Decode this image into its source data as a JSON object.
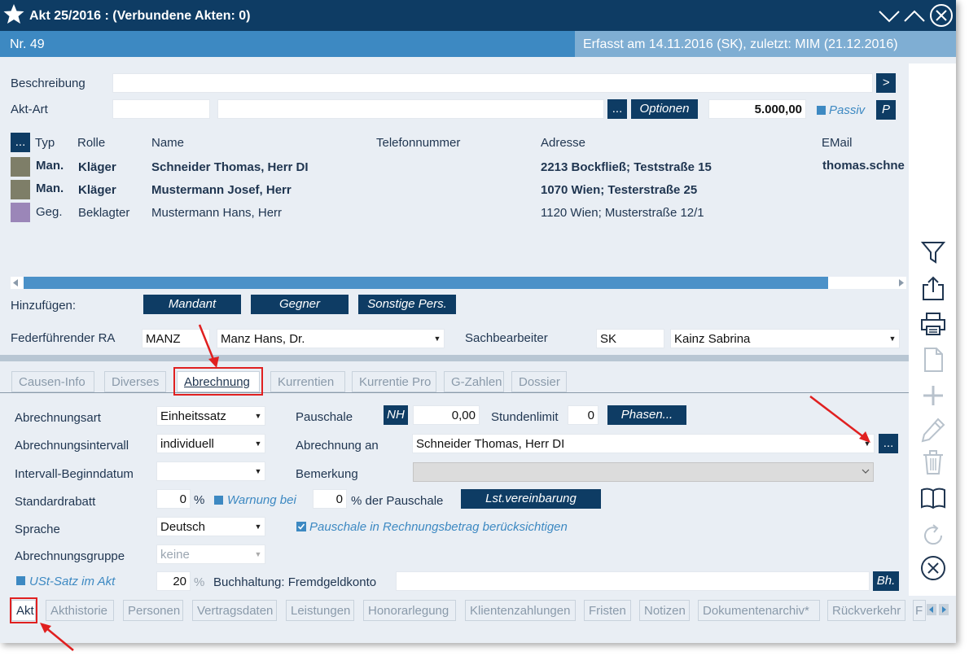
{
  "window": {
    "title": "Akt 25/2016 :  (Verbundene Akten: 0)",
    "nr": "Nr. 49",
    "erfasst": "Erfasst am 14.11.2016 (SK), zuletzt: MIM (21.12.2016)"
  },
  "form": {
    "beschreibung_label": "Beschreibung",
    "beschreibung_value": "",
    "aktart_label": "Akt-Art",
    "aktart_value": "",
    "aktart_desc": "",
    "dots": "...",
    "optionen_label": "Optionen",
    "betrag": "5.000,00",
    "passiv_label": "Passiv",
    "p_label": "P",
    "go_label": ">"
  },
  "persons": {
    "headers": {
      "dots": "...",
      "typ": "Typ",
      "rolle": "Rolle",
      "name": "Name",
      "telefon": "Telefonnummer",
      "adresse": "Adresse",
      "email": "EMail"
    },
    "rows": [
      {
        "typ": "Man.",
        "rolle": "Kläger",
        "name": "Schneider Thomas, Herr DI",
        "telefon": "",
        "adresse": "2213 Bockfließ; Teststraße 15",
        "email": "thomas.schne",
        "color": "#7e7e68"
      },
      {
        "typ": "Man.",
        "rolle": "Kläger",
        "name": "Mustermann Josef, Herr",
        "telefon": "",
        "adresse": "1070 Wien; Testerstraße 25",
        "email": "",
        "color": "#7e7e68"
      },
      {
        "typ": "Geg.",
        "rolle": "Beklagter",
        "name": "Mustermann Hans, Herr",
        "telefon": "",
        "adresse": "1120 Wien; Musterstraße 12/1",
        "email": "",
        "color": "#9b86b8"
      }
    ]
  },
  "hinzufuegen": {
    "label": "Hinzufügen:",
    "mandant": "Mandant",
    "gegner": "Gegner",
    "sonstige": "Sonstige Pers."
  },
  "ra": {
    "label": "Federführender RA",
    "code": "MANZ",
    "name": "Manz Hans, Dr.",
    "sach_label": "Sachbearbeiter",
    "sach_code": "SK",
    "sach_name": "Kainz Sabrina"
  },
  "tabs": [
    "Causen-Info",
    "Diverses",
    "Abrechnung",
    "Kurrentien",
    "Kurrentie Pro",
    "G-Zahlen",
    "Dossier"
  ],
  "abrechnung": {
    "art_label": "Abrechnungsart",
    "art_value": "Einheitssatz",
    "intervall_label": "Abrechnungsintervall",
    "intervall_value": "individuell",
    "beginn_label": "Intervall-Beginndatum",
    "beginn_value": "",
    "rabatt_label": "Standardrabatt",
    "rabatt_value": "0",
    "percent": "%",
    "sprache_label": "Sprache",
    "sprache_value": "Deutsch",
    "gruppe_label": "Abrechnungsgruppe",
    "gruppe_value": "keine",
    "ust_label": "USt-Satz im Akt",
    "ust_value": "20",
    "pauschale_label": "Pauschale",
    "nh_label": "NH",
    "pauschale_value": "0,00",
    "stundenlimit_label": "Stundenlimit",
    "stundenlimit_value": "0",
    "phasen_label": "Phasen...",
    "an_label": "Abrechnung an",
    "an_value": "Schneider Thomas, Herr DI",
    "bemerkung_label": "Bemerkung",
    "bemerkung_value": "",
    "warnung_label": "Warnung bei",
    "warnung_value": "0",
    "der_pauschale": "% der Pauschale",
    "lst_label": "Lst.vereinbarung",
    "pausch_check_label": "Pauschale in Rechnungsbetrag berücksichtigen",
    "buchhaltung_label": "Buchhaltung: Fremdgeldkonto",
    "buchhaltung_value": "",
    "bh_label": "Bh."
  },
  "bottom_tabs": [
    "Akt",
    "Akthistorie",
    "Personen",
    "Vertragsdaten",
    "Leistungen",
    "Honorarlegung",
    "Klientenzahlungen",
    "Fristen",
    "Notizen",
    "Dokumentenarchiv*",
    "Rückverkehr",
    "F"
  ]
}
